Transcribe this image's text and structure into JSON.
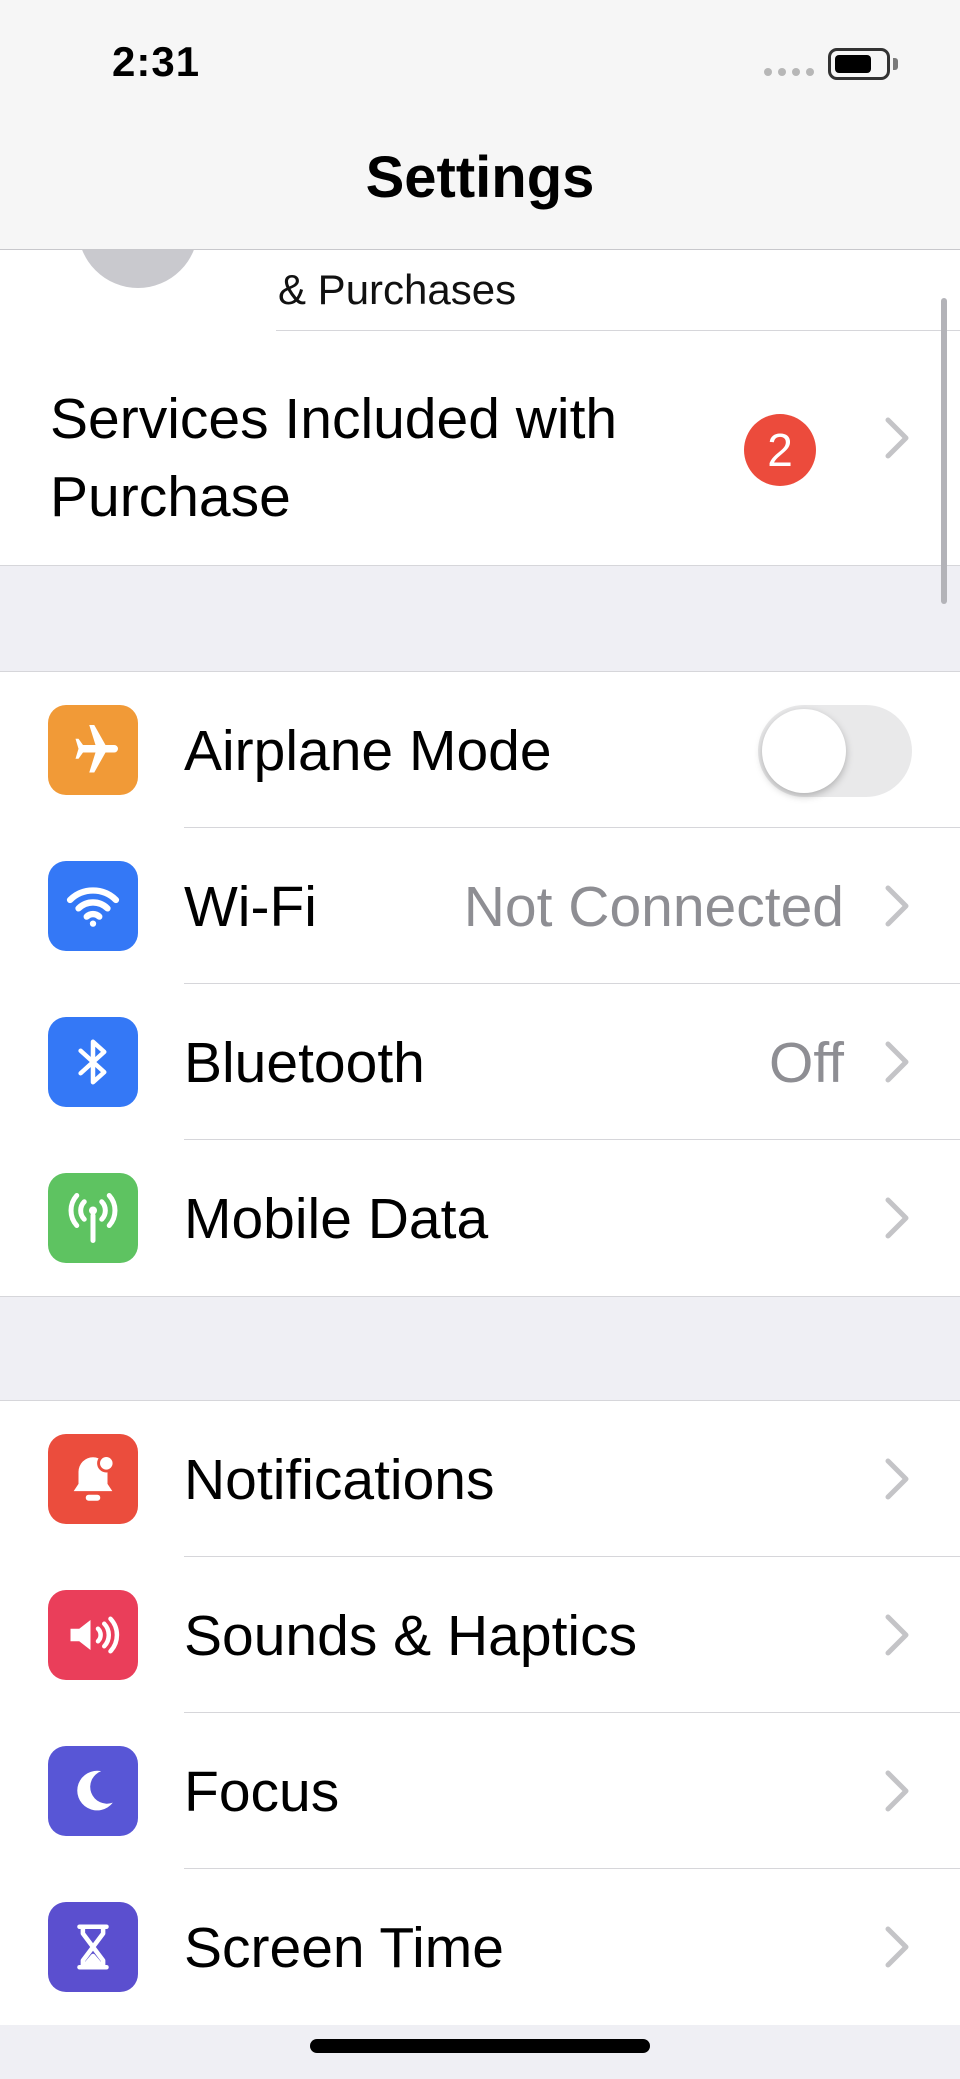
{
  "status_bar": {
    "time": "2:31"
  },
  "nav": {
    "title": "Settings"
  },
  "account": {
    "subtitle": "& Purchases",
    "services_label": "Services Included with Purchase",
    "services_badge": "2"
  },
  "connectivity": [
    {
      "label": "Airplane Mode",
      "icon": "airplane-icon",
      "color": "#f19a37",
      "toggle": false
    },
    {
      "label": "Wi-Fi",
      "icon": "wifi-icon",
      "color": "#3478f6",
      "value": "Not Connected"
    },
    {
      "label": "Bluetooth",
      "icon": "bluetooth-icon",
      "color": "#3478f6",
      "value": "Off"
    },
    {
      "label": "Mobile Data",
      "icon": "antenna-icon",
      "color": "#5ec361"
    }
  ],
  "general": [
    {
      "label": "Notifications",
      "icon": "bell-icon",
      "color": "#eb4d3d"
    },
    {
      "label": "Sounds & Haptics",
      "icon": "speaker-icon",
      "color": "#ea3e5a"
    },
    {
      "label": "Focus",
      "icon": "moon-icon",
      "color": "#5856d6"
    },
    {
      "label": "Screen Time",
      "icon": "hourglass-icon",
      "color": "#5b4fcf"
    }
  ]
}
